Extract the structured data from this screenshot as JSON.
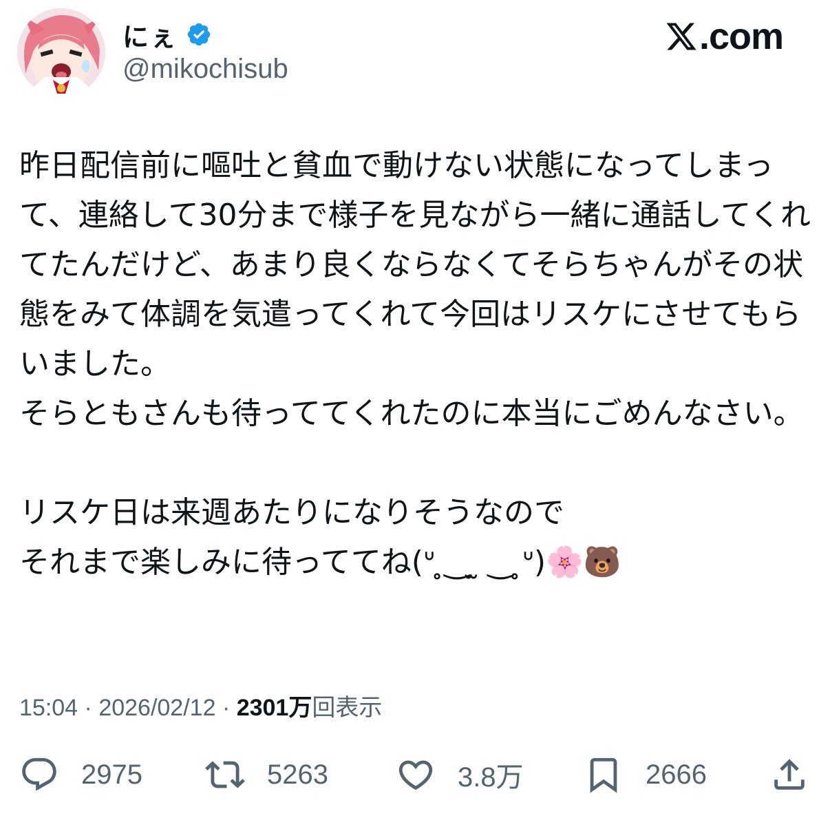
{
  "author": {
    "display_name": "にぇ",
    "handle": "@mikochisub",
    "verified_icon": "verified-badge-icon",
    "avatar_icon": "anime-avatar"
  },
  "brand": {
    "logo_icon": "x-logo-icon",
    "text": ".com"
  },
  "tweet": {
    "text": "昨日配信前に嘔吐と貧血で動けない状態になってしまって、連絡して30分まで様子を見ながら一緒に通話してくれてたんだけど、あまり良くならなくてそらちゃんがその状態をみて体調を気遣ってくれて今回はリスケにさせてもらいました。\nそらともさんも待っててくれたのに本当にごめんなさい。\n\nリスケ日は来週あたりになりそうなので\nそれまで楽しみに待っててね(ᐡ ̥‿ ̫ ‿ ̥ᐡ)🌸🐻"
  },
  "meta": {
    "time": "15:04",
    "separator": " · ",
    "date": "2026/02/12",
    "views_count": "2301万",
    "views_label": "回表示"
  },
  "actions": {
    "reply": {
      "icon": "reply-icon",
      "count": "2975"
    },
    "retweet": {
      "icon": "retweet-icon",
      "count": "5263"
    },
    "like": {
      "icon": "heart-icon",
      "count": "3.8万"
    },
    "bookmark": {
      "icon": "bookmark-icon",
      "count": "2666"
    },
    "share": {
      "icon": "share-icon"
    }
  },
  "colors": {
    "text_primary": "#0f1419",
    "text_secondary": "#536471",
    "verified_blue": "#1d9bf0"
  }
}
